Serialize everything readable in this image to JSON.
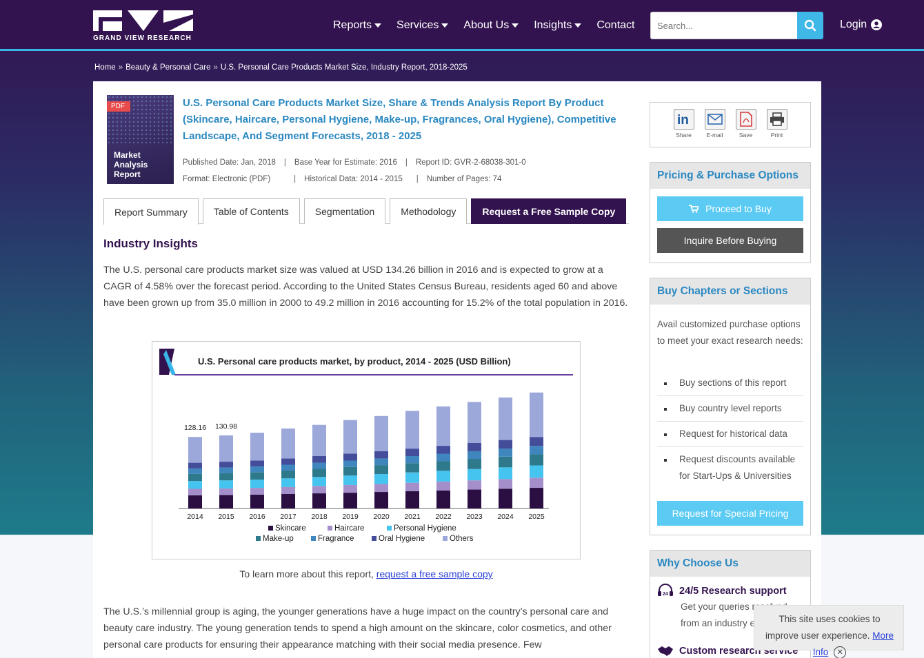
{
  "header": {
    "logo_text": "GRAND VIEW RESEARCH",
    "nav": [
      {
        "label": "Reports",
        "dropdown": true
      },
      {
        "label": "Services",
        "dropdown": true
      },
      {
        "label": "About Us",
        "dropdown": true
      },
      {
        "label": "Insights",
        "dropdown": true
      },
      {
        "label": "Contact",
        "dropdown": false
      }
    ],
    "search_placeholder": "Search...",
    "login_label": "Login"
  },
  "breadcrumb": [
    "Home",
    "Beauty & Personal Care",
    "U.S. Personal Care Products Market Size, Industry Report, 2018-2025"
  ],
  "cover": {
    "tag": "PDF",
    "text": "Market\nAnalysis\nReport"
  },
  "report": {
    "title": "U.S. Personal Care Products Market Size, Share & Trends Analysis Report By Product (Skincare, Haircare, Personal Hygiene, Make-up, Fragrances, Oral Hygiene), Competitive Landscape, And Segment Forecasts, 2018 - 2025",
    "meta_row1": [
      "Published Date: Jan, 2018",
      "Base Year for Estimate: 2016",
      "Report ID: GVR-2-68038-301-0"
    ],
    "meta_row2": [
      "Format: Electronic (PDF)",
      "Historical Data: 2014 - 2015",
      "Number of Pages: 74"
    ]
  },
  "tabs": [
    "Report Summary",
    "Table of Contents",
    "Segmentation",
    "Methodology",
    "Request a Free Sample Copy"
  ],
  "insights": {
    "heading": "Industry Insights",
    "para1": "The U.S. personal care products market size was valued at USD 134.26 billion in 2016 and is expected to grow at a CAGR of 4.58% over the forecast period. According to the United States Census Bureau, residents aged 60 and above have been grown up from 35.0 million in 2000 to 49.2 million in 2016 accounting for 15.2% of the total population in 2016.",
    "learn_prefix": "To learn more about this report,",
    "learn_link": "request a free sample copy",
    "para2": "The U.S.’s millennial group is aging, the younger generations have a huge impact on the country’s personal care and beauty care industry. The young generation tends to spend a high amount on the skincare, color cosmetics, and other personal care products for ensuring their appearance matching with their social media presence.  Few"
  },
  "chart_data": {
    "type": "bar",
    "stacked": true,
    "title": "U.S. Personal care products market, by product, 2014 - 2025 (USD Billion)",
    "categories": [
      "2014",
      "2015",
      "2016",
      "2017",
      "2018",
      "2019",
      "2020",
      "2021",
      "2022",
      "2023",
      "2024",
      "2025"
    ],
    "data_labels": {
      "2014": "128.16",
      "2015": "130.98"
    },
    "series": [
      {
        "name": "Skincare",
        "color": "#2b0f42",
        "values": [
          23.7,
          24.2,
          24.8,
          25.9,
          27.1,
          28.3,
          29.6,
          31.0,
          32.4,
          33.9,
          35.4,
          37.0
        ]
      },
      {
        "name": "Haircare",
        "color": "#a48fcb",
        "values": [
          11.5,
          11.8,
          12.1,
          12.6,
          13.2,
          13.8,
          14.4,
          15.1,
          15.8,
          16.5,
          17.3,
          18.1
        ]
      },
      {
        "name": "Personal Hygiene",
        "color": "#45c4ef",
        "values": [
          14.1,
          14.4,
          14.8,
          15.4,
          16.1,
          16.9,
          17.6,
          18.4,
          19.3,
          20.2,
          21.1,
          22.0
        ]
      },
      {
        "name": "Make-up",
        "color": "#2e7a8c",
        "values": [
          12.8,
          13.1,
          13.4,
          14.0,
          14.6,
          15.3,
          16.0,
          16.7,
          17.5,
          18.3,
          19.1,
          20.0
        ]
      },
      {
        "name": "Fragrance",
        "color": "#3f86bf",
        "values": [
          9.6,
          9.8,
          10.1,
          10.5,
          11.0,
          11.5,
          12.0,
          12.6,
          13.1,
          13.7,
          14.4,
          15.0
        ]
      },
      {
        "name": "Oral Hygiene",
        "color": "#434d9a",
        "values": [
          10.3,
          10.5,
          10.8,
          11.3,
          11.8,
          12.3,
          12.9,
          13.5,
          14.1,
          14.7,
          15.4,
          16.1
        ]
      },
      {
        "name": "Others",
        "color": "#9ca8da",
        "values": [
          46.2,
          47.2,
          49.8,
          53.6,
          55.9,
          60.4,
          63.2,
          67.6,
          70.6,
          73.6,
          76.2,
          79.6
        ]
      }
    ],
    "ylim": [
      0,
      245
    ],
    "grid": false,
    "legend": "bottom"
  },
  "sidebar": {
    "share": [
      "Share",
      "E-mail",
      "Save",
      "Print"
    ],
    "pricing_head": "Pricing & Purchase Options",
    "buy_label": "Proceed to Buy",
    "inquire_label": "Inquire Before Buying",
    "chapters_head": "Buy Chapters or Sections",
    "chapters_text": "Avail customized purchase options to meet your exact research needs:",
    "chapters_items": [
      "Buy sections of this report",
      "Buy country level reports",
      "Request for historical data",
      "Request discounts available for Start-Ups & Universities"
    ],
    "special_pricing_label": "Request for Special Pricing",
    "why_head": "Why Choose Us",
    "why1_title": "24/5 Research support",
    "why1_text": "Get your queries resolved from an industry expert.",
    "why2_title": "Custom research service"
  },
  "cookie": {
    "text": "This site uses cookies to improve user experience.",
    "link": "More Info",
    "close": "✕"
  }
}
